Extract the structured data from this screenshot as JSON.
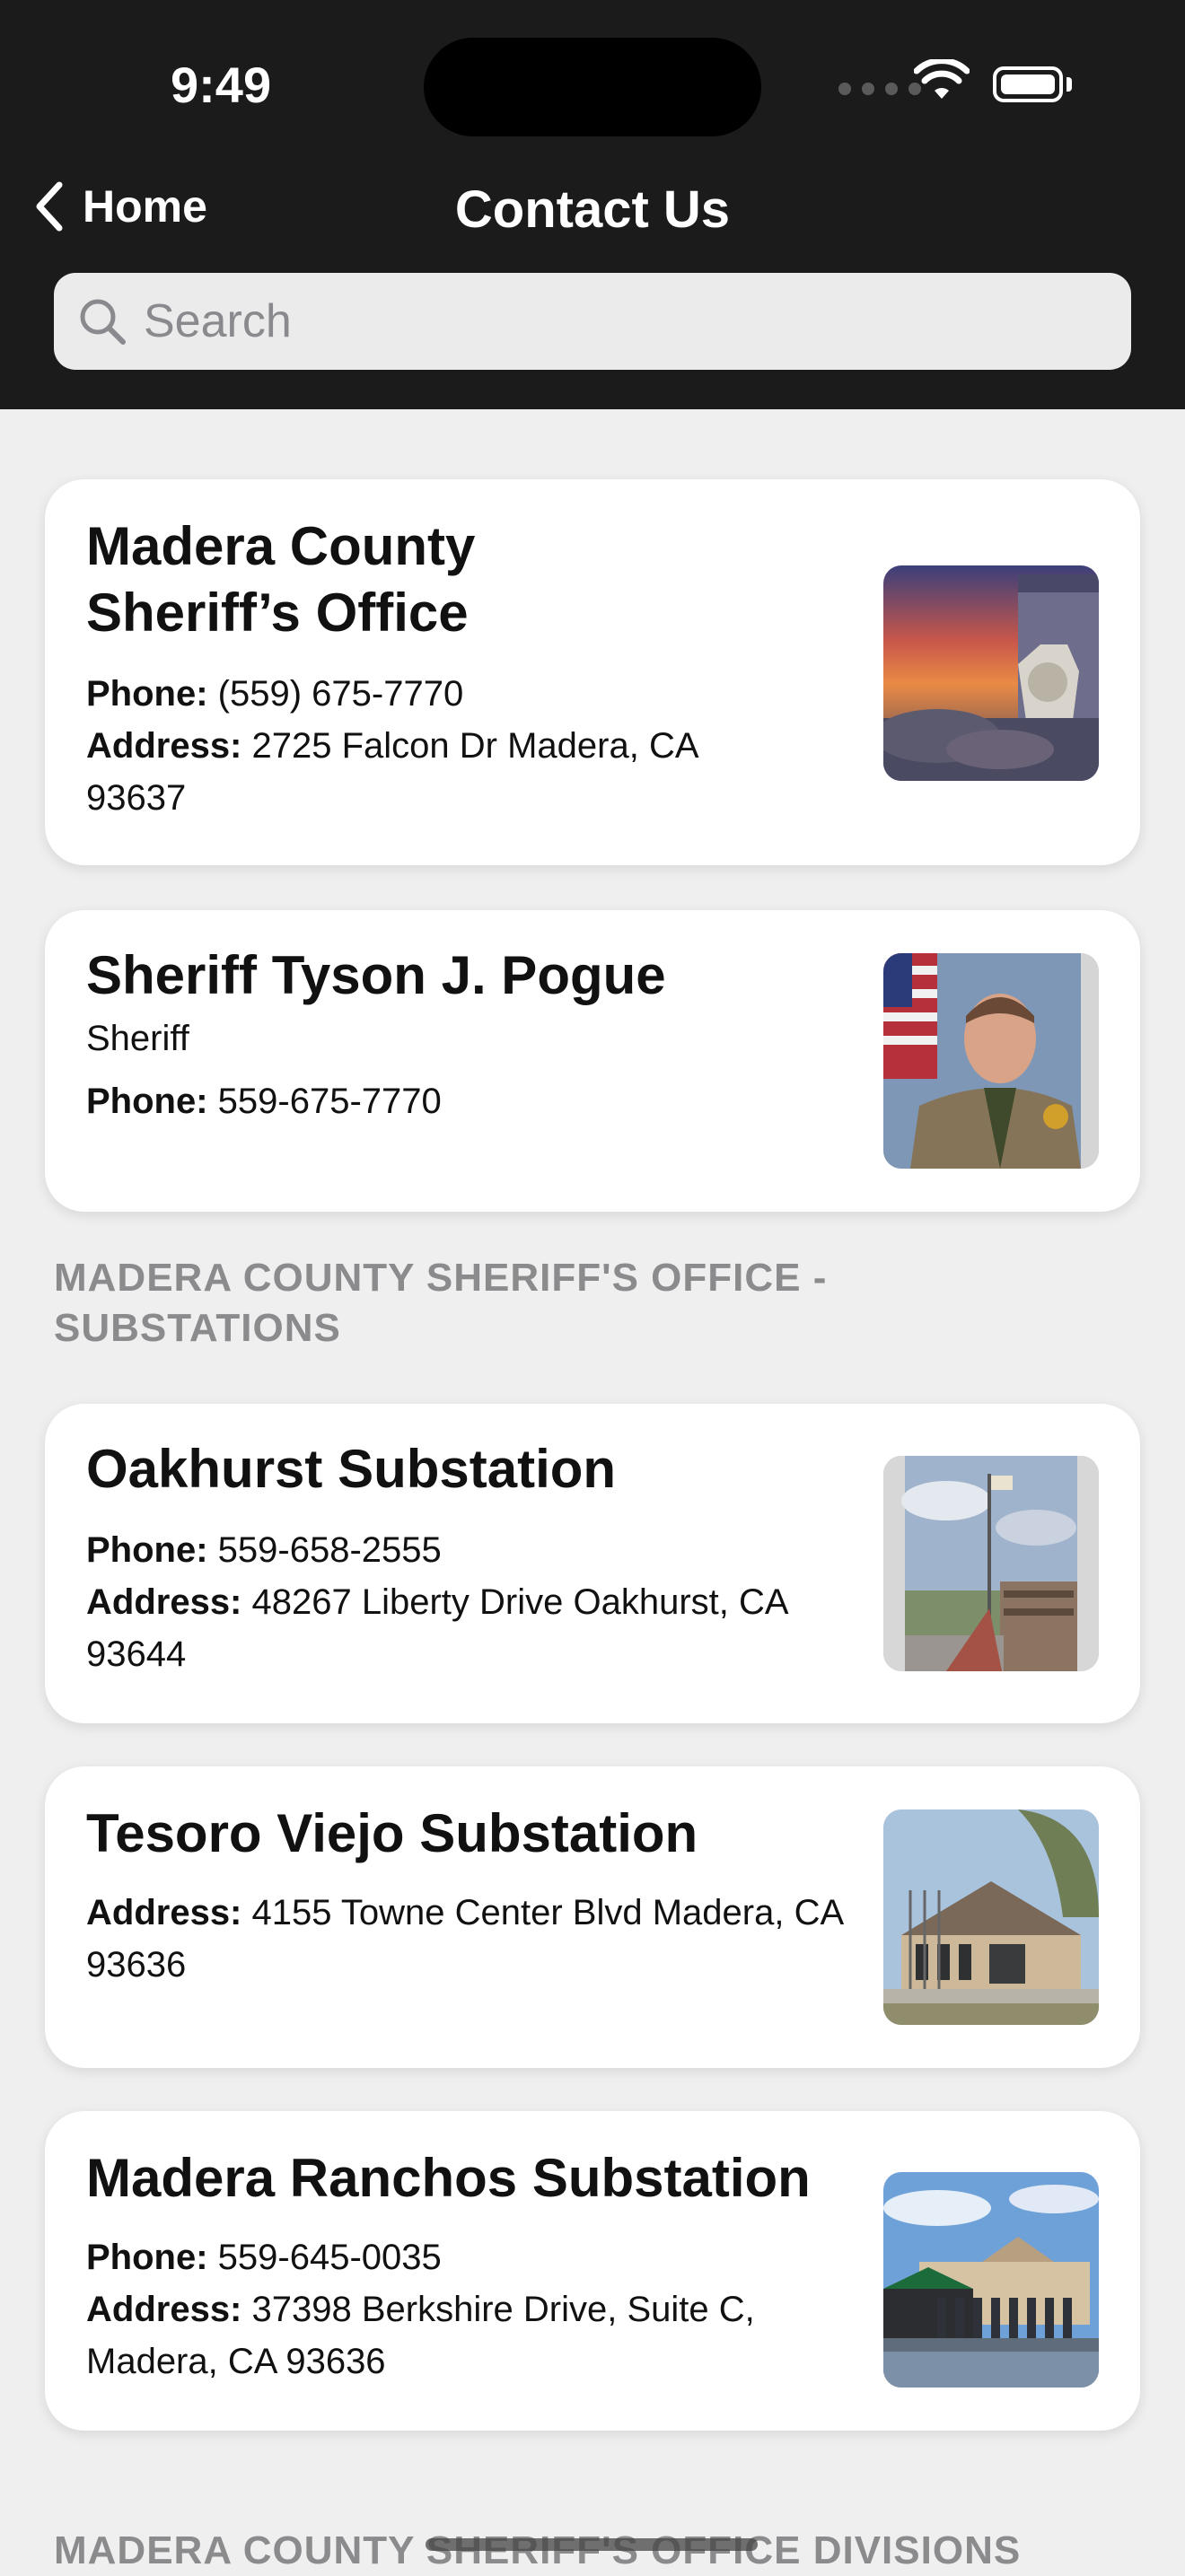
{
  "status_bar": {
    "time": "9:49"
  },
  "nav": {
    "back_label": "Home",
    "title": "Contact Us"
  },
  "search": {
    "placeholder": "Search"
  },
  "cards": [
    {
      "title": "Madera County Sheriff’s Office",
      "phone_label": "Phone:",
      "phone": "(559) 675-7770",
      "address_label": "Address:",
      "address": "2725 Falcon Dr Madera, CA 93637"
    },
    {
      "title": "Sheriff Tyson J. Pogue",
      "subtitle": "Sheriff",
      "phone_label": "Phone:",
      "phone": "559-675-7770"
    },
    {
      "title": "Oakhurst Substation",
      "phone_label": "Phone:",
      "phone": "559-658-2555",
      "address_label": "Address:",
      "address": "48267 Liberty Drive Oakhurst, CA 93644"
    },
    {
      "title": "Tesoro Viejo Substation",
      "address_label": "Address:",
      "address": "4155 Towne Center Blvd Madera, CA 93636"
    },
    {
      "title": "Madera Ranchos Substation",
      "phone_label": "Phone:",
      "phone": "559-645-0035",
      "address_label": "Address:",
      "address": "37398 Berkshire Drive, Suite C, Madera, CA 93636"
    }
  ],
  "sections": [
    "MADERA COUNTY SHERIFF'S OFFICE - SUBSTATIONS",
    "MADERA COUNTY SHERIFF'S OFFICE DIVISIONS"
  ]
}
